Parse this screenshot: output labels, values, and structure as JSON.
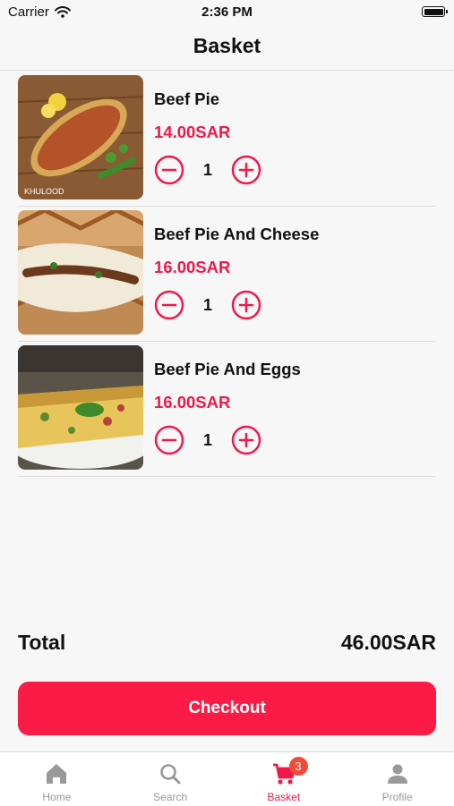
{
  "status_bar": {
    "carrier": "Carrier",
    "time": "2:36 PM"
  },
  "header": {
    "title": "Basket"
  },
  "cart": {
    "items": [
      {
        "name": "Beef Pie",
        "price": "14.00SAR",
        "quantity": "1",
        "image_watermark": "KHULOOD"
      },
      {
        "name": "Beef Pie And Cheese",
        "price": "16.00SAR",
        "quantity": "1"
      },
      {
        "name": "Beef Pie And Eggs",
        "price": "16.00SAR",
        "quantity": "1"
      }
    ]
  },
  "summary": {
    "total_label": "Total",
    "total_value": "46.00SAR"
  },
  "checkout": {
    "label": "Checkout"
  },
  "tabbar": {
    "items": [
      {
        "label": "Home",
        "icon": "home-icon"
      },
      {
        "label": "Search",
        "icon": "search-icon"
      },
      {
        "label": "Basket",
        "icon": "cart-icon",
        "badge": "3"
      },
      {
        "label": "Profile",
        "icon": "person-icon"
      }
    ],
    "active": "Basket"
  },
  "colors": {
    "accent": "#f0194a",
    "button": "#fc1b47",
    "badge": "#f04a3a",
    "inactive": "#999999"
  }
}
